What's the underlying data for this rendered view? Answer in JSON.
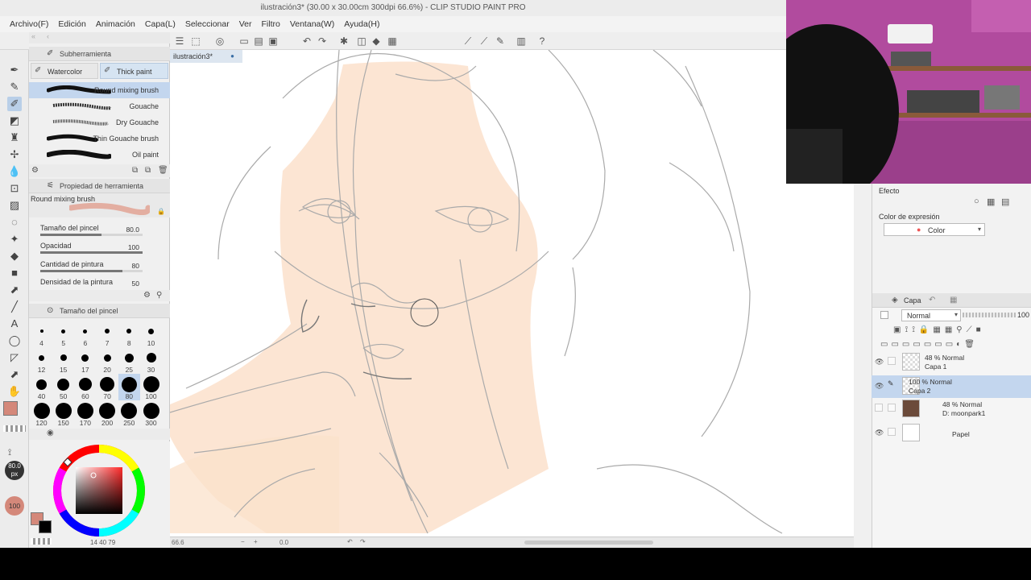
{
  "window": {
    "title": "ilustración3* (30.00 x 30.00cm 300dpi 66.6%)  - CLIP STUDIO PAINT PRO"
  },
  "menu": [
    "Archivo(F)",
    "Edición",
    "Animación",
    "Capa(L)",
    "Seleccionar",
    "Ver",
    "Filtro",
    "Ventana(W)",
    "Ayuda(H)"
  ],
  "canvas": {
    "tab_label": "ilustración3*",
    "zoom": "66.6",
    "rotation": "0.0"
  },
  "subtool": {
    "header": "Subherramienta",
    "tabs": [
      "Watercolor",
      "Thick paint"
    ],
    "active_tab": "Thick paint",
    "brushes": [
      {
        "label": "Round mixing brush",
        "selected": true
      },
      {
        "label": "Gouache",
        "selected": false
      },
      {
        "label": "Dry Gouache",
        "selected": false
      },
      {
        "label": "Thin Gouache brush",
        "selected": false
      },
      {
        "label": "Oil paint",
        "selected": false
      }
    ]
  },
  "tool_property": {
    "header": "Propiedad de herramienta",
    "brush_name": "Round mixing brush",
    "rows": [
      {
        "label": "Tamaño del pincel",
        "value": "80.0",
        "fill": 0.6
      },
      {
        "label": "Opacidad",
        "value": "100",
        "fill": 1.0
      },
      {
        "label": "Cantidad de pintura",
        "value": "80",
        "fill": 0.8
      },
      {
        "label": "Densidad de la pintura",
        "value": "50",
        "fill": 0.5
      }
    ]
  },
  "brush_size": {
    "header": "Tamaño del pincel",
    "sizes": [
      "4",
      "5",
      "6",
      "7",
      "8",
      "10",
      "12",
      "15",
      "17",
      "20",
      "25",
      "30",
      "40",
      "50",
      "60",
      "70",
      "80",
      "100",
      "120",
      "150",
      "170",
      "200",
      "250",
      "300"
    ],
    "selected": "80"
  },
  "color": {
    "main": "#d4887a",
    "sub": "#000000",
    "size_badge": "80.0",
    "size_unit": "px",
    "opacity_badge": "100",
    "wheel_readout": [
      "14",
      "40",
      "79"
    ]
  },
  "effect_panel": {
    "header": "Efecto",
    "expression_label": "Color de expresión",
    "expression_value": "Color"
  },
  "layer_panel": {
    "tab_label": "Capa",
    "blend_mode": "Normal",
    "opacity": "100",
    "layers": [
      {
        "line1": "48 % Normal",
        "line2": "Capa 1",
        "selected": false,
        "visible": true
      },
      {
        "line1": "100 % Normal",
        "line2": "Capa 2",
        "selected": true,
        "visible": true
      },
      {
        "line1": "48 % Normal",
        "line2": "D: moonpark1",
        "selected": false,
        "visible": false
      },
      {
        "line1": "",
        "line2": "Papel",
        "selected": false,
        "visible": true
      }
    ]
  }
}
